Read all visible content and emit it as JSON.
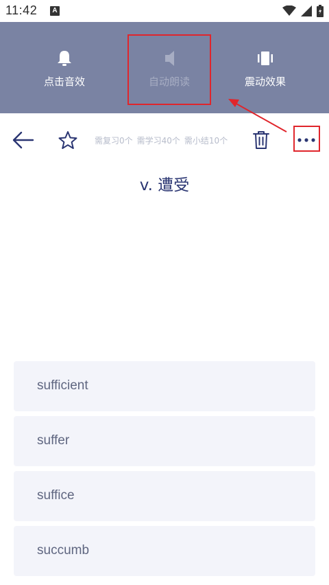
{
  "status_bar": {
    "time": "11:42",
    "notification_icon": "A",
    "icons": [
      "wifi-icon",
      "signal-icon",
      "battery-icon"
    ]
  },
  "settings": {
    "options": [
      {
        "label": "点击音效",
        "icon": "bell-icon",
        "enabled": true
      },
      {
        "label": "自动朗读",
        "icon": "speaker-icon",
        "enabled": false
      },
      {
        "label": "震动效果",
        "icon": "vibrate-icon",
        "enabled": true
      }
    ],
    "panel_color": "#7a83a3"
  },
  "toolbar": {
    "back_icon": "arrow-left-icon",
    "star_icon": "star-icon",
    "stats": {
      "review": "需复习0个",
      "learn": "需学习40个",
      "summary": "需小结10个"
    },
    "trash_icon": "trash-icon",
    "more_icon": "more-horizontal-icon"
  },
  "question": {
    "meaning": "v. 遭受"
  },
  "choices": [
    "sufficient",
    "suffer",
    "suffice",
    "succumb"
  ],
  "annotation": {
    "color": "#e0252b"
  }
}
